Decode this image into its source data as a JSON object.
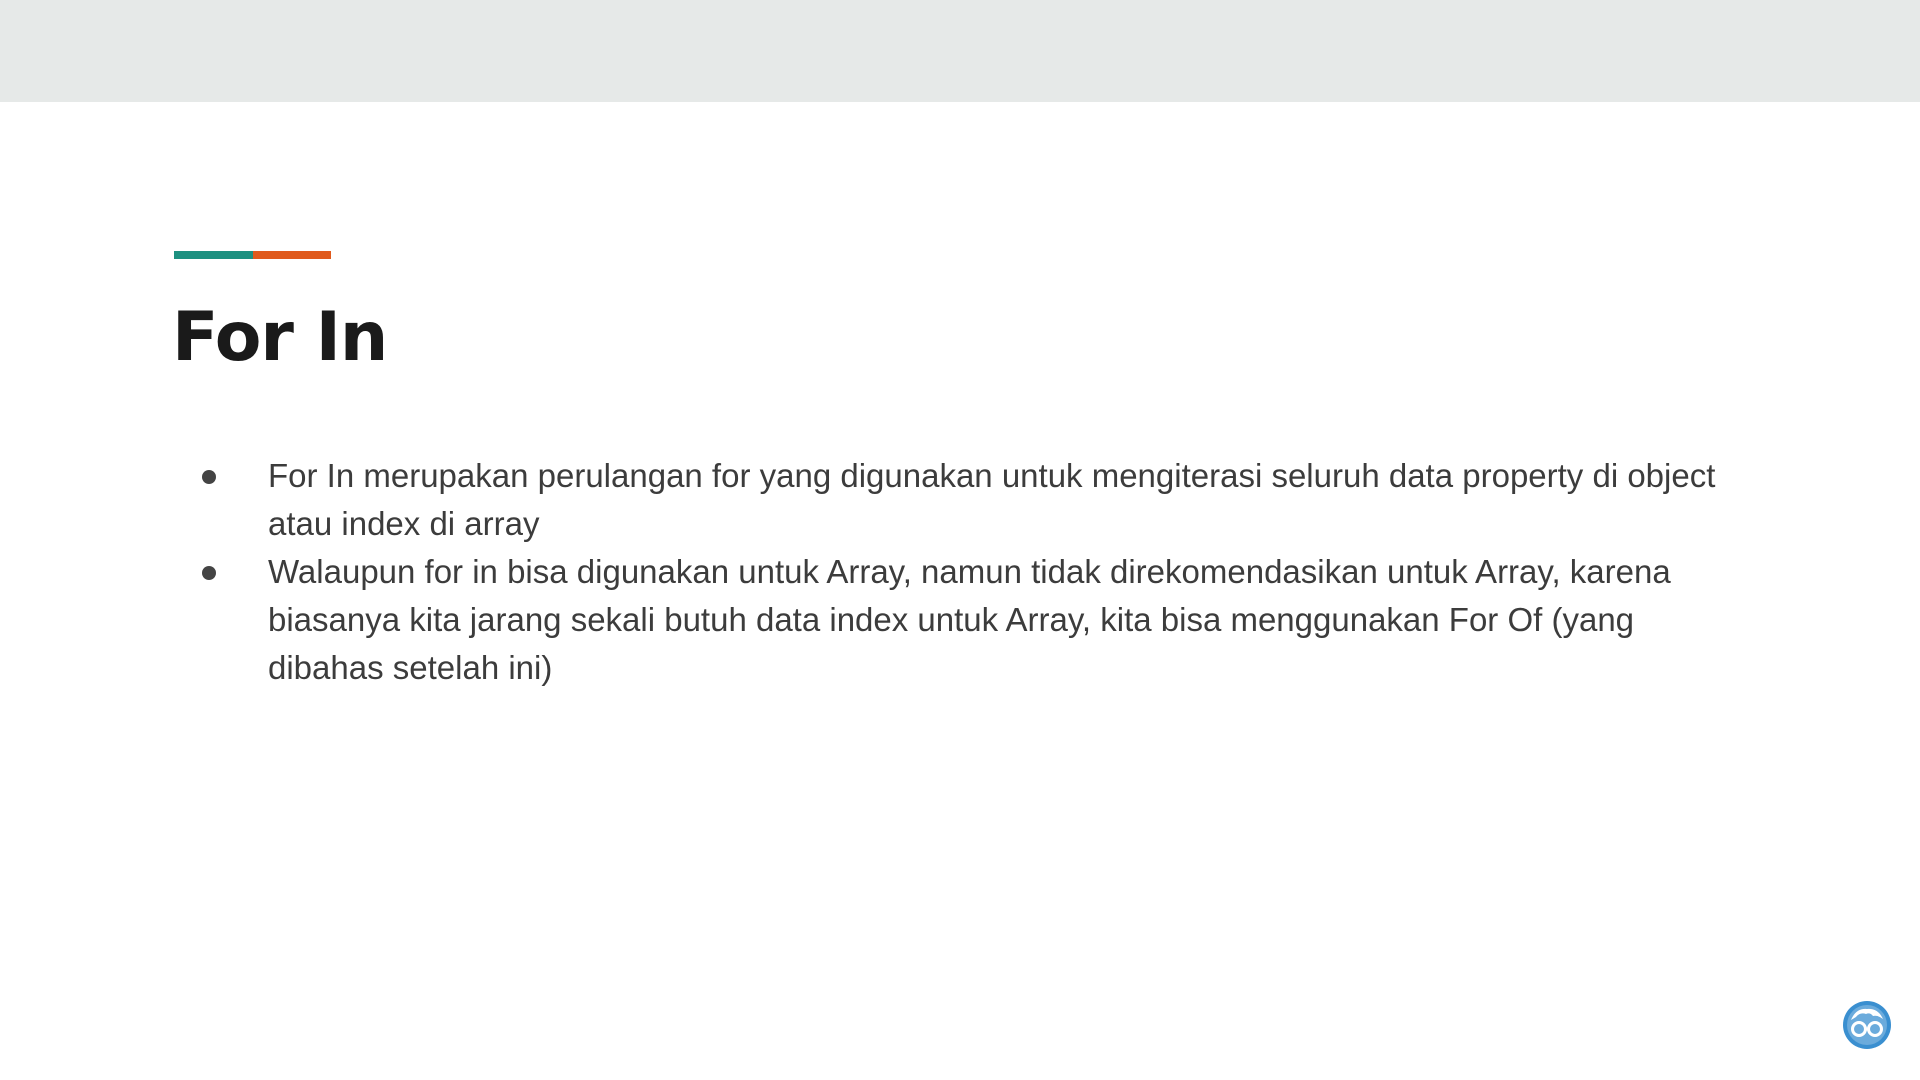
{
  "slide": {
    "title": "For In",
    "accent_colors": [
      "#1d9080",
      "#e05a1d"
    ],
    "background_band_color": "#e6e9e8",
    "bullets": [
      {
        "text": "For In merupakan perulangan for yang digunakan untuk mengiterasi seluruh data property di object atau index di array"
      },
      {
        "text": "Walaupun for in bisa digunakan untuk Array, namun tidak direkomendasikan untuk Array, karena biasanya kita jarang sekali butuh data index untuk Array, kita bisa menggunakan For Of (yang dibahas setelah ini)"
      }
    ],
    "logo_icon": "glasses-avatar-icon",
    "logo_color": "#3a8fd0"
  }
}
